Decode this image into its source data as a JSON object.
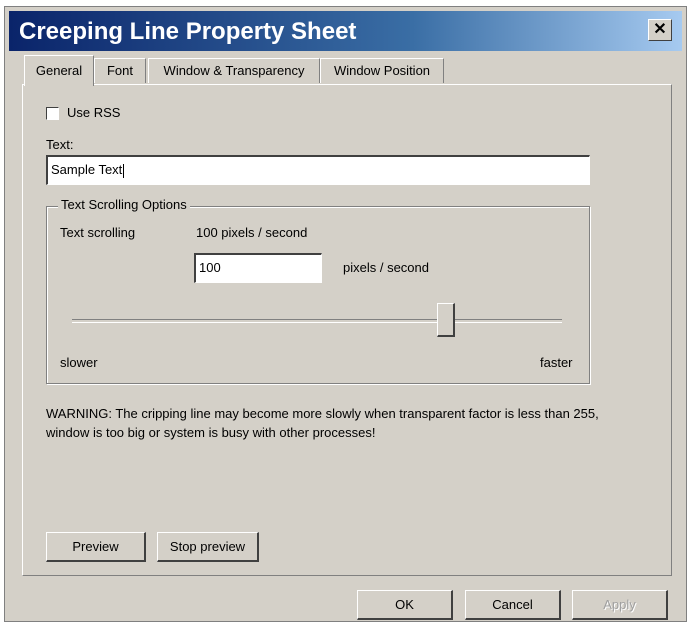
{
  "window": {
    "title": "Creeping Line Property Sheet",
    "close_label": "✕"
  },
  "tabs": [
    {
      "label": "General",
      "active": true
    },
    {
      "label": "Font",
      "active": false
    },
    {
      "label": "Window & Transparency",
      "active": false
    },
    {
      "label": "Window Position",
      "active": false
    }
  ],
  "general": {
    "use_rss_label": "Use RSS",
    "use_rss_checked": false,
    "text_label": "Text:",
    "text_value": "Sample Text",
    "scrolling_group": {
      "legend": "Text Scrolling Options",
      "scrolling_label": "Text scrolling",
      "current_speed_text": "100 pixels / second",
      "speed_value": "100",
      "speed_unit": "pixels / second",
      "slider_min_label": "slower",
      "slider_max_label": "faster"
    },
    "warning": "WARNING: The cripping line may become more slowly when transparent factor is less than 255, window is too big or system is busy with other processes!",
    "preview_button": "Preview",
    "stop_preview_button": "Stop preview"
  },
  "footer": {
    "ok_button": "OK",
    "cancel_button": "Cancel",
    "apply_button": "Apply"
  }
}
